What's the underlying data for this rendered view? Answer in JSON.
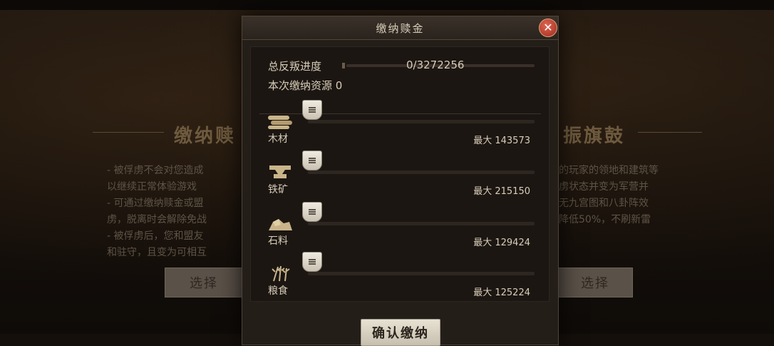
{
  "background": {
    "title_left": "缴纳赎",
    "title_right": "振旗鼓",
    "text_left": [
      "- 被俘虏不会对您造成",
      "以继续正常体验游戏",
      "- 可通过缴纳赎金或盟",
      "虏，脱离时会解除免战",
      "- 被俘虏后，您和盟友",
      "和驻守，且变为可相互"
    ],
    "text_right": [
      "的玩家的领地和建筑等",
      "虏状态并变为军营并",
      "",
      "",
      "无九宫图和八卦阵效",
      "降低50%，不刷新雷"
    ],
    "button_left": "选择",
    "button_right": "选择"
  },
  "dialog": {
    "title": "缴纳赎金",
    "close_icon": "close-icon",
    "total_label": "总反叛进度",
    "total_value": "0/3272256",
    "current_label": "本次缴纳资源 0",
    "resources": [
      {
        "icon": "wood-logs-icon",
        "name": "木材",
        "max": "最大 143573",
        "slider_value": 0
      },
      {
        "icon": "iron-anvil-icon",
        "name": "铁矿",
        "max": "最大 215150",
        "slider_value": 0
      },
      {
        "icon": "stone-rocks-icon",
        "name": "石料",
        "max": "最大 129424",
        "slider_value": 0
      },
      {
        "icon": "grain-wheat-icon",
        "name": "粮食",
        "max": "最大 125224",
        "slider_value": 0
      }
    ],
    "confirm_label": "确认缴纳"
  },
  "colors": {
    "accent": "#b58a4e",
    "close": "#a02a1c",
    "panel": "#241e19"
  }
}
